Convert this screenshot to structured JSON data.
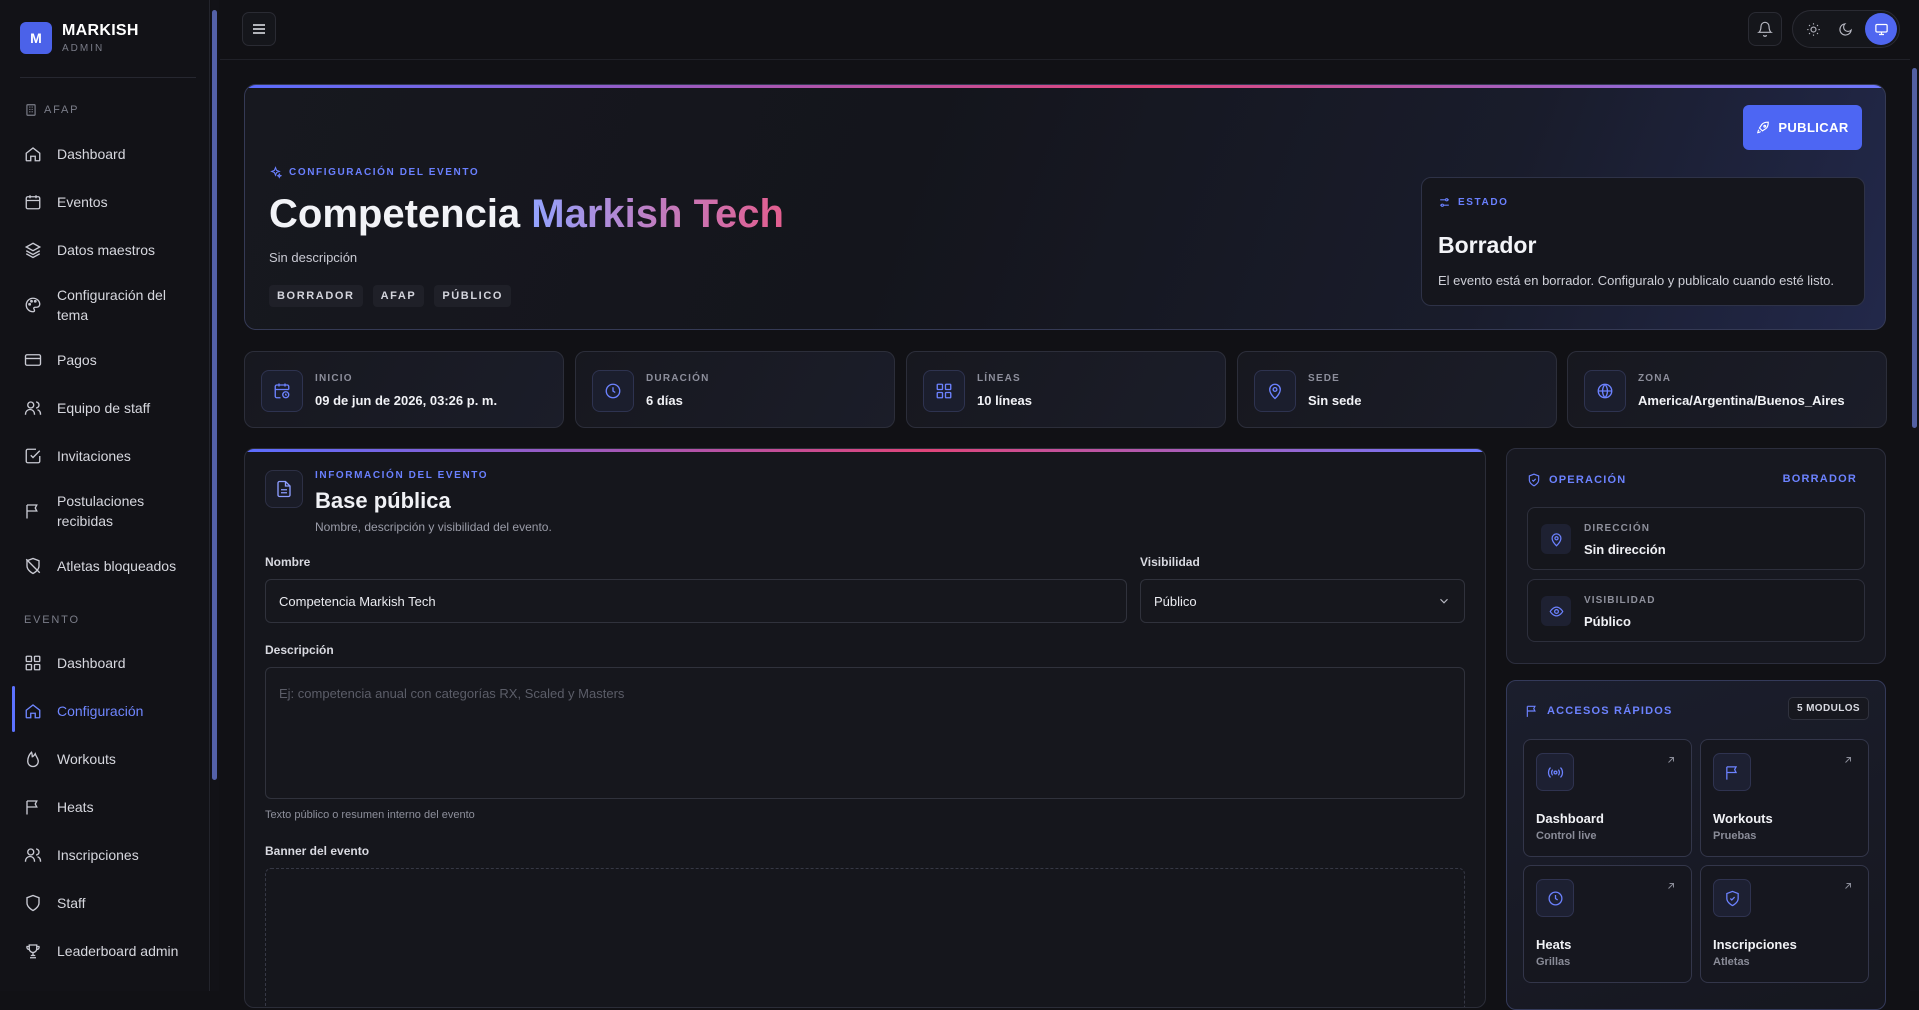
{
  "brand": {
    "logo_letter": "M",
    "name": "MARKISH",
    "sub": "ADMIN"
  },
  "sidebar": {
    "org_label": "AFAP",
    "org_items": [
      {
        "label": "Dashboard",
        "icon": "home-icon"
      },
      {
        "label": "Eventos",
        "icon": "calendar-icon"
      },
      {
        "label": "Datos maestros",
        "icon": "layers-icon"
      },
      {
        "label": "Configuración del tema",
        "icon": "palette-icon"
      },
      {
        "label": "Pagos",
        "icon": "credit-card-icon"
      },
      {
        "label": "Equipo de staff",
        "icon": "users-icon"
      },
      {
        "label": "Invitaciones",
        "icon": "check-square-icon"
      },
      {
        "label": "Postulaciones recibidas",
        "icon": "flag-icon"
      },
      {
        "label": "Atletas bloqueados",
        "icon": "shield-off-icon"
      }
    ],
    "event_label": "EVENTO",
    "event_items": [
      {
        "label": "Dashboard",
        "icon": "grid-icon"
      },
      {
        "label": "Configuración",
        "icon": "home-icon",
        "active": true
      },
      {
        "label": "Workouts",
        "icon": "flame-icon"
      },
      {
        "label": "Heats",
        "icon": "flag-icon"
      },
      {
        "label": "Inscripciones",
        "icon": "users-icon"
      },
      {
        "label": "Staff",
        "icon": "shield-icon"
      },
      {
        "label": "Leaderboard admin",
        "icon": "trophy-icon"
      }
    ]
  },
  "hero": {
    "kicker": "CONFIGURACIÓN DEL EVENTO",
    "title_plain": "Competencia ",
    "title_grad": "Markish Tech",
    "description": "Sin descripción",
    "tags": [
      "BORRADOR",
      "AFAP",
      "PÚBLICO"
    ],
    "publish_label": "PUBLICAR",
    "estado": {
      "kicker": "ESTADO",
      "title": "Borrador",
      "desc": "El evento está en borrador. Configuralo y publicalo cuando esté listo."
    }
  },
  "stats": [
    {
      "label": "INICIO",
      "value": "09 de jun de 2026, 03:26 p. m.",
      "icon": "calendar-clock-icon"
    },
    {
      "label": "DURACIÓN",
      "value": "6 días",
      "icon": "clock-icon"
    },
    {
      "label": "LÍNEAS",
      "value": "10 líneas",
      "icon": "grid-icon"
    },
    {
      "label": "SEDE",
      "value": "Sin sede",
      "icon": "map-pin-icon"
    },
    {
      "label": "ZONA",
      "value": "America/Argentina/Buenos_Aires",
      "icon": "globe-icon"
    }
  ],
  "info": {
    "kicker": "INFORMACIÓN DEL EVENTO",
    "title": "Base pública",
    "subtitle": "Nombre, descripción y visibilidad del evento.",
    "name_label": "Nombre",
    "name_value": "Competencia Markish Tech",
    "vis_label": "Visibilidad",
    "vis_value": "Público",
    "desc_label": "Descripción",
    "desc_placeholder": "Ej: competencia anual con categorías RX, Scaled y Masters",
    "desc_help": "Texto público o resumen interno del evento",
    "banner_label": "Banner del evento"
  },
  "operacion": {
    "title": "OPERACIÓN",
    "status": "BORRADOR",
    "items": [
      {
        "label": "DIRECCIÓN",
        "value": "Sin dirección",
        "icon": "map-pin-icon"
      },
      {
        "label": "VISIBILIDAD",
        "value": "Público",
        "icon": "eye-icon"
      }
    ]
  },
  "accesos": {
    "title": "ACCESOS RÁPIDOS",
    "badge": "5 MODULOS",
    "cards": [
      {
        "title": "Dashboard",
        "sub": "Control live",
        "icon": "broadcast-icon"
      },
      {
        "title": "Workouts",
        "sub": "Pruebas",
        "icon": "flag-icon"
      },
      {
        "title": "Heats",
        "sub": "Grillas",
        "icon": "clock-icon"
      },
      {
        "title": "Inscripciones",
        "sub": "Atletas",
        "icon": "shield-check-icon"
      }
    ]
  },
  "colors": {
    "accent": "#4d66f3",
    "bg": "#111115",
    "gradient_pink": "#e0457a"
  }
}
